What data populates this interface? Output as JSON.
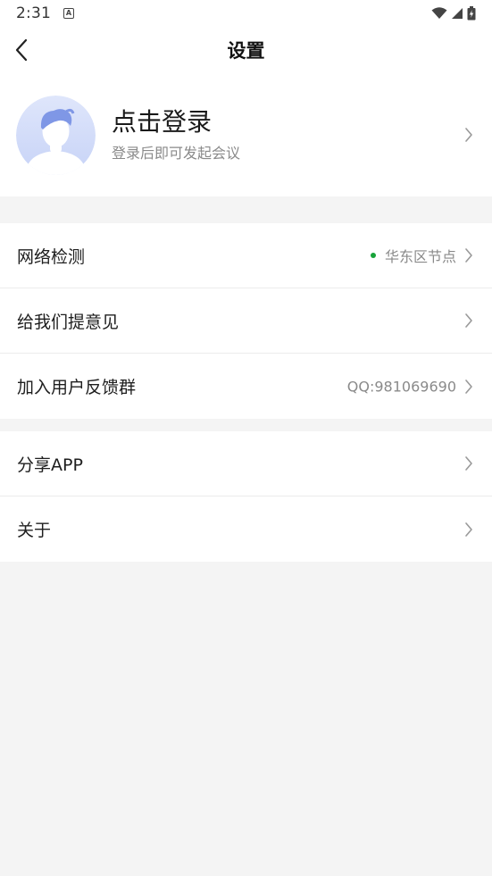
{
  "status_bar": {
    "time": "2:31",
    "notification_icon": "a-letter-icon",
    "icons": [
      "wifi-icon",
      "signal-icon",
      "battery-charging-icon"
    ]
  },
  "nav": {
    "title": "设置",
    "back_icon": "chevron-left-icon"
  },
  "profile": {
    "title": "点击登录",
    "subtitle": "登录后即可发起会议",
    "avatar_icon": "default-avatar-icon"
  },
  "settings": {
    "group1": [
      {
        "label": "网络检测",
        "value": "华东区节点",
        "status_color": "#18a33a"
      },
      {
        "label": "给我们提意见",
        "value": ""
      },
      {
        "label": "加入用户反馈群",
        "value": "QQ:981069690"
      }
    ],
    "group2": [
      {
        "label": "分享APP",
        "value": ""
      },
      {
        "label": "关于",
        "value": ""
      }
    ]
  },
  "colors": {
    "background": "#f4f4f4",
    "card": "#ffffff",
    "accent_status": "#18a33a",
    "avatar_blue": "#7f97e6"
  }
}
